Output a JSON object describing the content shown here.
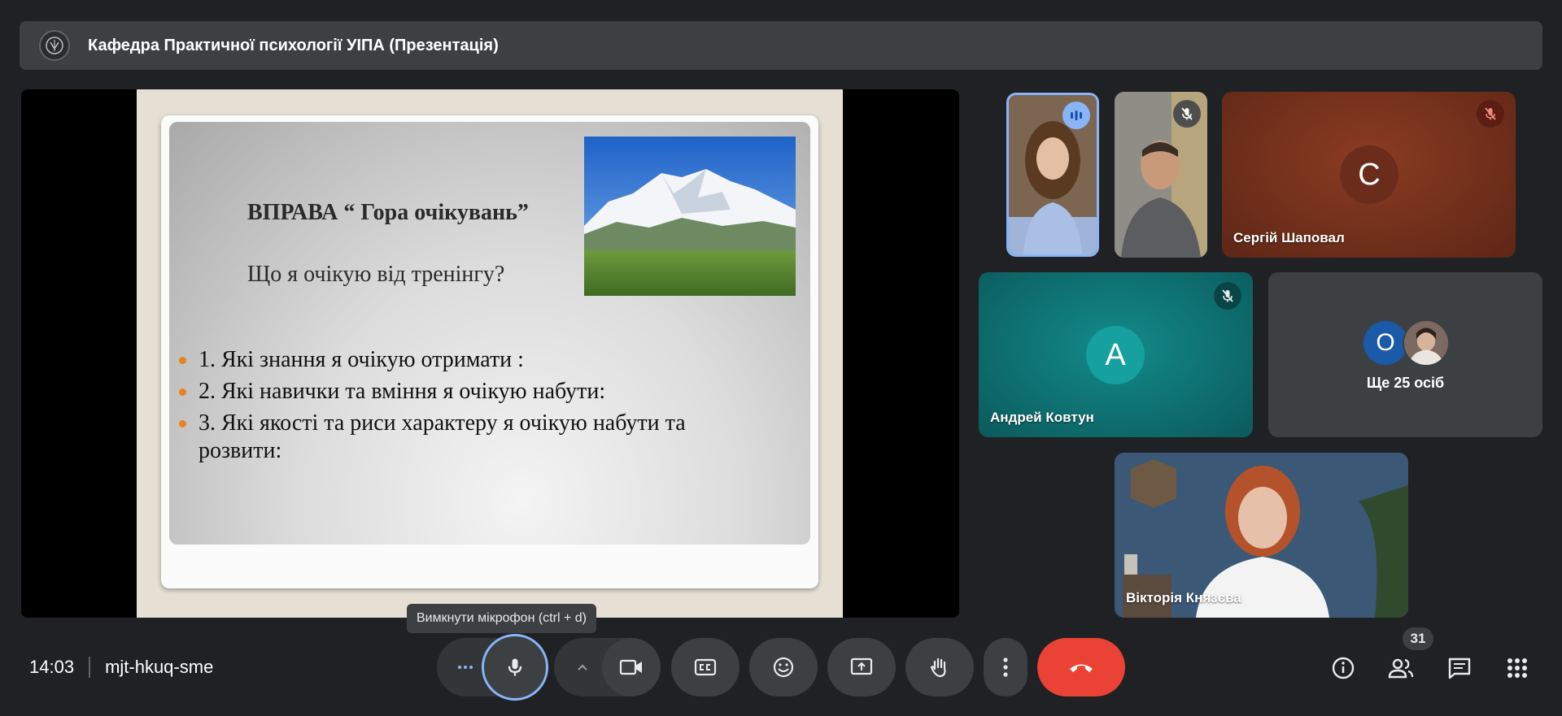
{
  "meeting": {
    "presentation_title": "Кафедра Практичної психології УІПА (Презентація)",
    "time": "14:03",
    "code": "mjt-hkuq-sme",
    "participant_count": "31"
  },
  "slide": {
    "title": "ВПРАВА “ Гора очікувань”",
    "question": "Що я очікую від тренінгу?",
    "bullets": [
      "1. Які знання я очікую отримати :",
      "2. Які навички та вміння я очікую набути:",
      "3. Які якості та риси характеру я очікую набути та розвити:"
    ]
  },
  "participants": {
    "sergii": {
      "name": "Сергій Шаповал",
      "initial": "С",
      "color": "#6b2c1c"
    },
    "andrei": {
      "name": "Андрей Ковтун",
      "initial": "A",
      "color": "#0f7778"
    },
    "others": {
      "label": "Ще 25 осіб",
      "initial": "O",
      "color": "#1a5aa8"
    },
    "viktoria": {
      "name": "Вікторія Князєва"
    }
  },
  "controls": {
    "tooltip": "Вимкнути мікрофон (ctrl + d)",
    "more_options_icon": "more-horizontal-icon",
    "mic_icon": "microphone-icon",
    "camera_icon": "videocam-icon",
    "captions_icon": "closed-captions-icon",
    "emoji_icon": "emoji-icon",
    "present_icon": "present-screen-icon",
    "hand_icon": "raise-hand-icon",
    "more_icon": "more-vertical-icon",
    "end_call_icon": "end-call-icon",
    "end_call_color": "#ea4335"
  },
  "right_toolbar": [
    "info-icon",
    "people-icon",
    "chat-icon",
    "activities-icon"
  ]
}
